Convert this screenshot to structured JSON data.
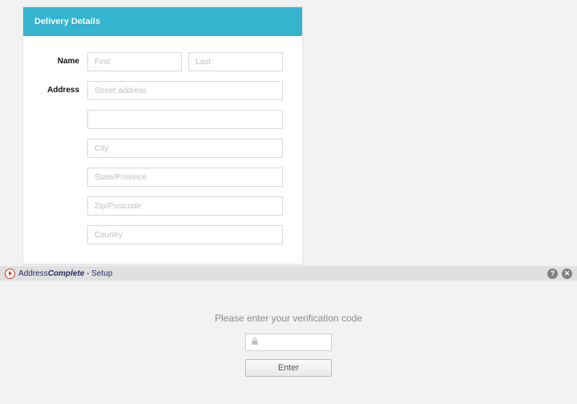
{
  "card": {
    "title": "Delivery Details",
    "name_label": "Name",
    "first_ph": "First",
    "last_ph": "Last",
    "address_label": "Address",
    "street_ph": "Street address",
    "line2_ph": "",
    "city_ph": "City",
    "state_ph": "State/Province",
    "zip_ph": "Zip/Postcode",
    "country_ph": "Country"
  },
  "toolbar": {
    "brand_prefix": "Address",
    "brand_bold": "Complete",
    "setup_suffix": " - Setup",
    "help_glyph": "?",
    "close_glyph": "✕"
  },
  "verify": {
    "prompt": "Please enter your verification code",
    "code_value": "",
    "enter_label": "Enter"
  }
}
